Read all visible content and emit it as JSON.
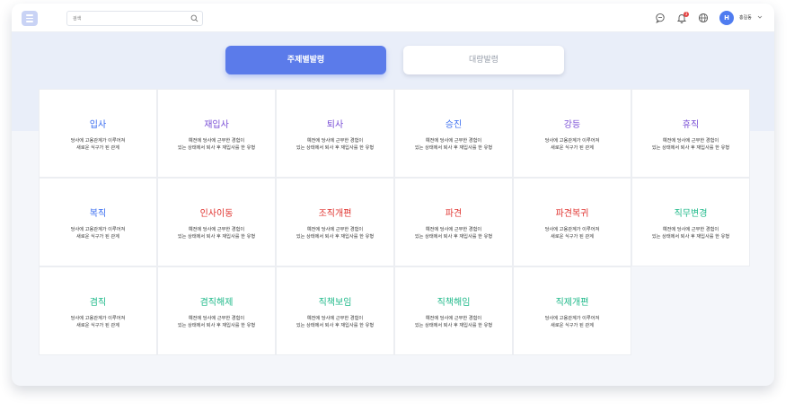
{
  "topbar": {
    "search_placeholder": "검색",
    "notification_count": "3",
    "user_initial": "H",
    "user_name": "홍길동"
  },
  "tabs": [
    {
      "label": "주제별발령",
      "active": true
    },
    {
      "label": "대량발령",
      "active": false
    }
  ],
  "colors": {
    "accent": "#5b7bea",
    "blue": "#3a6df0",
    "purple": "#7a4fd6",
    "red": "#e0332f",
    "green": "#1fb98a"
  },
  "cards": [
    {
      "title": "입사",
      "color": "blue",
      "desc": "당사에 고용관계가 이루어져\n새로운 식구가 된 관계"
    },
    {
      "title": "재입사",
      "color": "purple",
      "desc": "예전에 당사에 근무한 경험이\n있는 상태에서 퇴사 후 재입사를 한 유형"
    },
    {
      "title": "퇴사",
      "color": "purple",
      "desc": "예전에 당사에 근무한 경험이\n있는 상태에서 퇴사 후 재입사를 한 유형"
    },
    {
      "title": "승진",
      "color": "blue",
      "desc": "예전에 당사에 근무한 경험이\n있는 상태에서 퇴사 후 재입사를 한 유형"
    },
    {
      "title": "강등",
      "color": "purple",
      "desc": "당사에 고용관계가 이루어져\n새로운 식구가 된 관계"
    },
    {
      "title": "휴직",
      "color": "purple",
      "desc": "예전에 당사에 근무한 경험이\n있는 상태에서 퇴사 후 재입사를 한 유형"
    },
    {
      "title": "복직",
      "color": "blue",
      "desc": "당사에 고용관계가 이루어져\n새로운 식구가 된 관계"
    },
    {
      "title": "인사이동",
      "color": "red",
      "desc": "예전에 당사에 근무한 경험이\n있는 상태에서 퇴사 후 재입사를 한 유형"
    },
    {
      "title": "조직개편",
      "color": "red",
      "desc": "예전에 당사에 근무한 경험이\n있는 상태에서 퇴사 후 재입사를 한 유형"
    },
    {
      "title": "파견",
      "color": "red",
      "desc": "예전에 당사에 근무한 경험이\n있는 상태에서 퇴사 후 재입사를 한 유형"
    },
    {
      "title": "파견복귀",
      "color": "red",
      "desc": "당사에 고용관계가 이루어져\n새로운 식구가 된 관계"
    },
    {
      "title": "직무변경",
      "color": "green",
      "desc": "예전에 당사에 근무한 경험이\n있는 상태에서 퇴사 후 재입사를 한 유형"
    },
    {
      "title": "겸직",
      "color": "green",
      "desc": "당사에 고용관계가 이루어져\n새로운 식구가 된 관계"
    },
    {
      "title": "겸직해제",
      "color": "green",
      "desc": "예전에 당사에 근무한 경험이\n있는 상태에서 퇴사 후 재입사를 한 유형"
    },
    {
      "title": "직책보임",
      "color": "green",
      "desc": "예전에 당사에 근무한 경험이\n있는 상태에서 퇴사 후 재입사를 한 유형"
    },
    {
      "title": "직책해임",
      "color": "green",
      "desc": "예전에 당사에 근무한 경험이\n있는 상태에서 퇴사 후 재입사를 한 유형"
    },
    {
      "title": "직제개편",
      "color": "green",
      "desc": "당사에 고용관계가 이루어져\n새로운 식구가 된 관계"
    }
  ]
}
